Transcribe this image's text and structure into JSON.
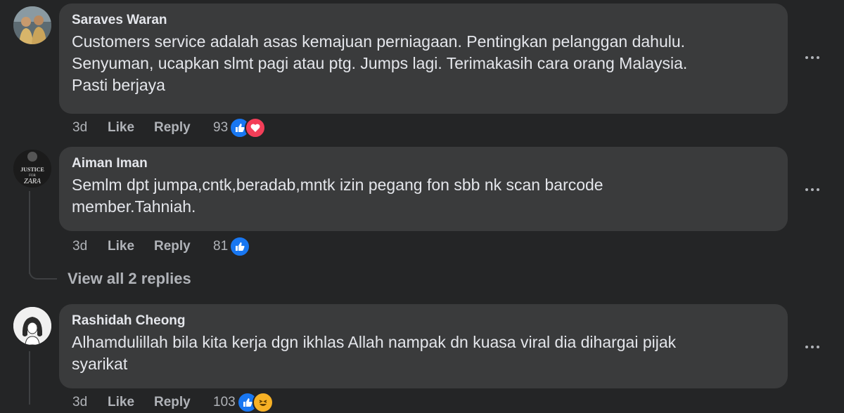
{
  "comments": [
    {
      "author": "Saraves Waran",
      "lines": [
        "Customers service adalah asas kemajuan perniagaan. Pentingkan pelanggan dahulu.",
        "Senyuman, ucapkan slmt pagi atau ptg. Jumps lagi. Terimakasih cara orang Malaysia.",
        "Pasti berjaya"
      ],
      "age": "3d",
      "like_label": "Like",
      "reply_label": "Reply",
      "reactions_count": "93",
      "reactions": [
        "like-icon",
        "love-icon"
      ]
    },
    {
      "author": "Aiman Iman",
      "avatar_text": [
        "JUSTICE",
        "FOR",
        "ZARA"
      ],
      "lines": [
        "Semlm dpt jumpa,cntk,beradab,mntk izin pegang fon sbb nk scan barcode",
        "member.Tahniah."
      ],
      "age": "3d",
      "like_label": "Like",
      "reply_label": "Reply",
      "reactions_count": "81",
      "reactions": [
        "like-icon"
      ]
    },
    {
      "author": "Rashidah Cheong",
      "lines": [
        "Alhamdulillah bila kita kerja dgn ikhlas Allah nampak dn kuasa viral dia dihargai pijak",
        "syarikat"
      ],
      "age": "3d",
      "like_label": "Like",
      "reply_label": "Reply",
      "reactions_count": "103",
      "reactions": [
        "like-icon",
        "haha-icon"
      ]
    }
  ],
  "view_replies_label": "View all 2 replies",
  "colors": {
    "background": "#242526",
    "bubble": "#3a3b3c",
    "text": "#e4e6eb",
    "secondary": "#b0b3b8",
    "like_blue": "#1877f2",
    "love_red": "#f33e58",
    "haha_yellow": "#f7b125"
  }
}
